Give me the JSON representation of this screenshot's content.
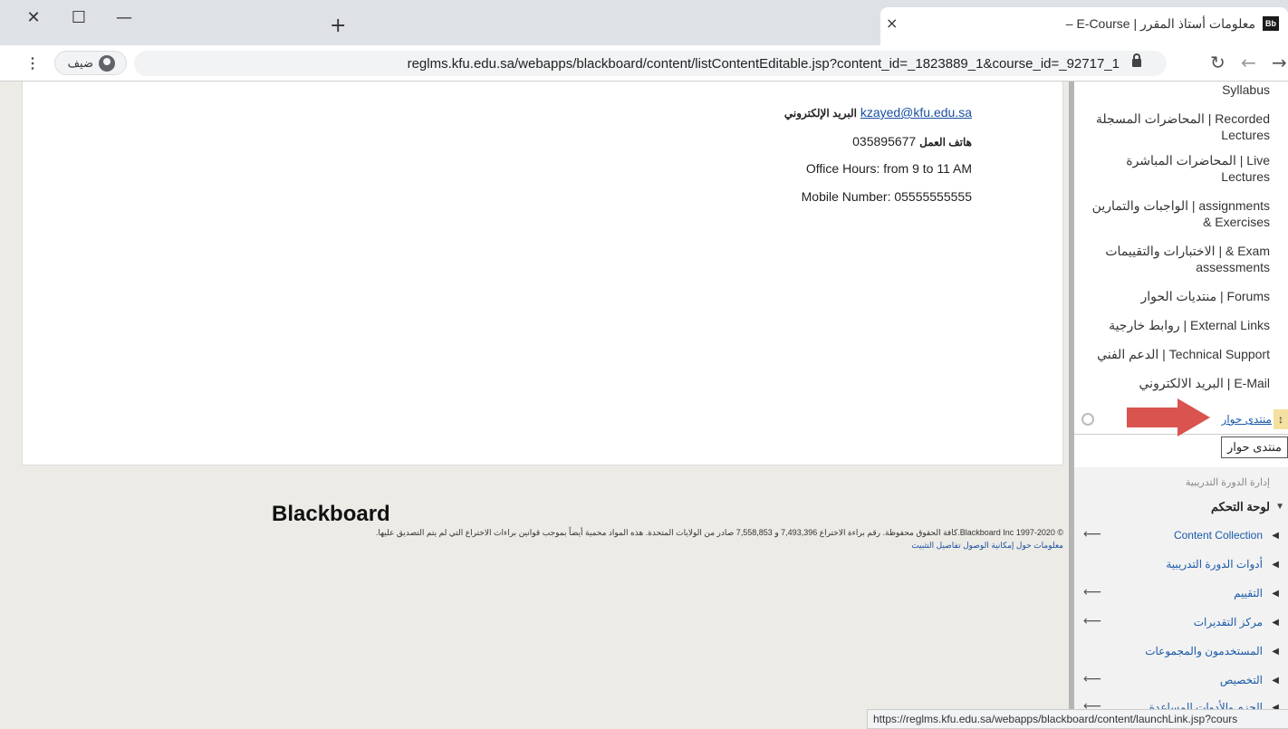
{
  "browser": {
    "tab": {
      "favicon": "Bb",
      "title": "معلومات أستاذ المقرر | E-Course –",
      "close": "×"
    },
    "new_tab": "+",
    "window_controls": {
      "close": "✕",
      "maximize": "☐",
      "minimize": "—"
    },
    "toolbar": {
      "menu": "⋮",
      "profile_label": "ضيف",
      "url": "reglms.kfu.edu.sa/webapps/blackboard/content/listContentEditable.jsp?content_id=_1823889_1&course_id=_92717_1",
      "reload": "↻",
      "back": "←",
      "forward": "→"
    },
    "status_url": "https://reglms.kfu.edu.sa/webapps/blackboard/content/launchLink.jsp?cours"
  },
  "content": {
    "email_label": "البريد الإلكتروني",
    "email": "kzayed@kfu.edu.sa",
    "phone_label": "هاتف العمل",
    "phone": "035895677",
    "office_hours": "Office Hours:  from 9 to 11 AM",
    "mobile": "Mobile Number: 05555555555"
  },
  "footer": {
    "logo": "Blackboard",
    "copyright": "© 1997-2020 Blackboard Inc.كافة الحقوق محفوظة. رقم براءة الاختراع 7,493,396 و 7,558,853 صادر من الولايات المتحدة. هذه المواد محمية أيضاً بموجب قوانين براءات الاختراع التي لم يتم التصديق عليها.",
    "links": "معلومات حول إمكانية الوصول  تفاصيل التثبيت"
  },
  "sidebar": {
    "items": [
      {
        "l1": "Syllabus",
        "l2": ""
      },
      {
        "l1": "المحاضرات المسجلة | Recorded",
        "l2": "Lectures"
      },
      {
        "l1": "المحاضرات المباشرة | Live",
        "l2": "Lectures"
      },
      {
        "l1": "الواجبات والتمارين | assignments",
        "l2": "& Exercises"
      },
      {
        "l1": "الاختبارات والتقييمات | & Exam",
        "l2": "assessments"
      },
      {
        "l1": "منتديات الحوار | Forums",
        "l2": ""
      },
      {
        "l1": "روابط خارجية | External Links",
        "l2": ""
      },
      {
        "l1": "الدعم الفني | Technical Support",
        "l2": ""
      },
      {
        "l1": "البريد الالكتروني | E-Mail",
        "l2": ""
      }
    ],
    "active_item": "منتدى حوار",
    "drag_handle": "↕",
    "tooltip": "منتدى حوار"
  },
  "management": {
    "title": "إدارة الدورة التدريبية",
    "heading": "لوحة التحكم",
    "items": [
      {
        "label": "Content Collection",
        "arrow": "⟵"
      },
      {
        "label": "أدوات الدورة التدريبية",
        "arrow": ""
      },
      {
        "label": "التقييم",
        "arrow": "⟵"
      },
      {
        "label": "مركز التقديرات",
        "arrow": "⟵"
      },
      {
        "label": "المستخدمون والمجموعات",
        "arrow": ""
      },
      {
        "label": "التخصيص",
        "arrow": "⟵"
      },
      {
        "label": "الحزم والأدوات المساعدة",
        "arrow": "⟵"
      }
    ],
    "triangle": "◀"
  }
}
